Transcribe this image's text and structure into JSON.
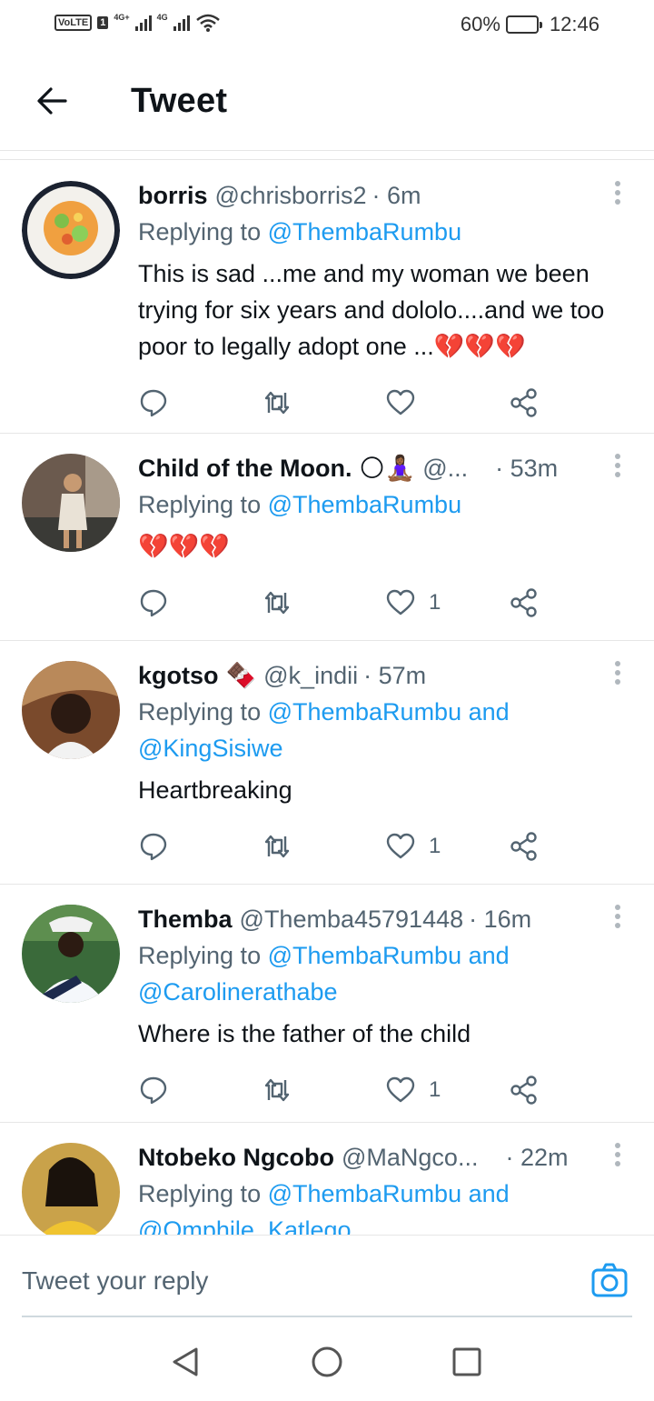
{
  "status_bar": {
    "volte": "VoLTE",
    "sim": "1",
    "net1": "4G+",
    "net2": "4G",
    "battery": "60%",
    "battery_level": 0.6,
    "time": "12:46"
  },
  "header": {
    "title": "Tweet"
  },
  "tweets": [
    {
      "name": "borris",
      "handle": "@chrisborris2",
      "time": "· 6m",
      "reply_prefix": "Replying to ",
      "mentions": "@ThembaRumbu",
      "content": "This is sad ...me and my woman we been trying for six years and dololo....and we too poor to legally adopt one ...💔💔💔",
      "likes": ""
    },
    {
      "name": "Child of the Moon.",
      "name_emoji": "🌕🧘🏾‍♀️",
      "handle": "@...",
      "time": "· 53m",
      "reply_prefix": "Replying to ",
      "mentions": "@ThembaRumbu",
      "content": "💔💔💔",
      "likes": "1"
    },
    {
      "name": "kgotso",
      "name_emoji": "🍫",
      "handle": "@k_indii",
      "time": "· 57m",
      "reply_prefix": "Replying to ",
      "mentions": "@ThembaRumbu and @KingSisiwe",
      "content": "Heartbreaking",
      "likes": "1"
    },
    {
      "name": "Themba",
      "handle": "@Themba45791448",
      "time": "· 16m",
      "reply_prefix": "Replying to ",
      "mentions": "@ThembaRumbu and @Carolinerathabe",
      "content": "Where is the father of the child",
      "likes": "1"
    },
    {
      "name": "Ntobeko Ngcobo",
      "handle": "@MaNgco...",
      "time": "· 22m",
      "reply_prefix": "Replying to ",
      "mentions": "@ThembaRumbu and @Omphile_Katlego",
      "content": "",
      "likes": ""
    }
  ],
  "reply_bar": {
    "placeholder": "Tweet your reply"
  },
  "icons": {
    "back": "arrow-left-icon",
    "more": "more-vertical-icon",
    "reply": "comment-icon",
    "retweet": "retweet-icon",
    "like": "heart-icon",
    "share": "share-icon",
    "camera": "camera-icon",
    "nav_back": "triangle-back-icon",
    "nav_home": "circle-home-icon",
    "nav_recents": "square-recents-icon"
  },
  "colors": {
    "accent": "#1d9bf0",
    "secondary_text": "#536471",
    "divider": "#e6e6e6"
  }
}
